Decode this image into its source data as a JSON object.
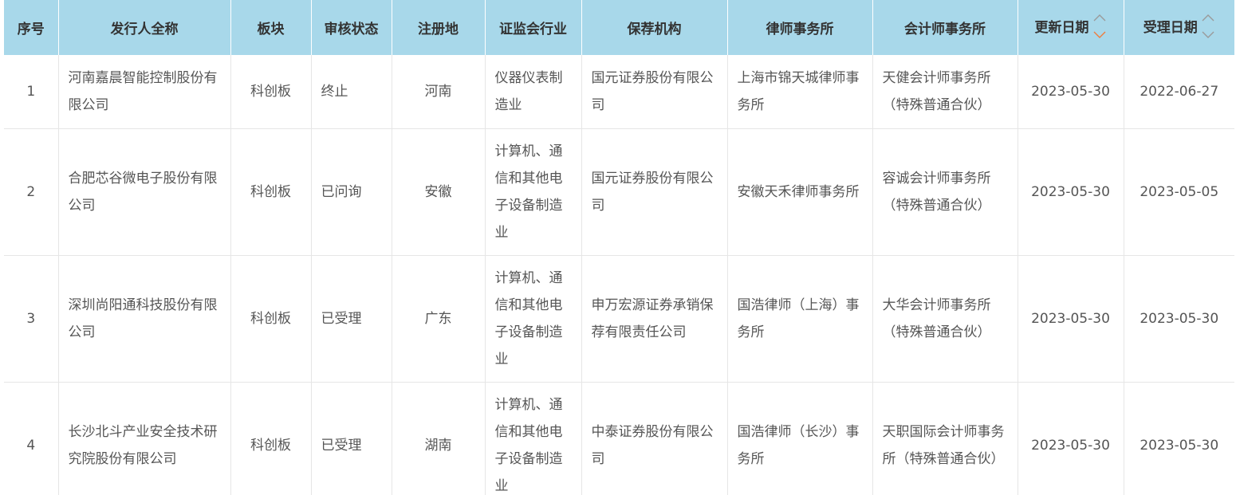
{
  "table": {
    "headers": [
      "序号",
      "发行人全称",
      "板块",
      "审核状态",
      "注册地",
      "证监会行业",
      "保荐机构",
      "律师事务所",
      "会计师事务所",
      "更新日期",
      "受理日期"
    ],
    "sort_colors": {
      "inactive": "#9a9a9a",
      "active": "#f07c3c"
    },
    "rows": [
      {
        "index": "1",
        "issuer": "河南嘉晨智能控制股份有限公司",
        "board": "科创板",
        "status": "终止",
        "region": "河南",
        "industry": "仪器仪表制造业",
        "sponsor": "国元证券股份有限公司",
        "law_firm": "上海市锦天城律师事务所",
        "accounting_firm": "天健会计师事务所（特殊普通合伙）",
        "updated": "2023-05-30",
        "accepted": "2022-06-27"
      },
      {
        "index": "2",
        "issuer": "合肥芯谷微电子股份有限公司",
        "board": "科创板",
        "status": "已问询",
        "region": "安徽",
        "industry": "计算机、通信和其他电子设备制造业",
        "sponsor": "国元证券股份有限公司",
        "law_firm": "安徽天禾律师事务所",
        "accounting_firm": "容诚会计师事务所（特殊普通合伙）",
        "updated": "2023-05-30",
        "accepted": "2023-05-05"
      },
      {
        "index": "3",
        "issuer": "深圳尚阳通科技股份有限公司",
        "board": "科创板",
        "status": "已受理",
        "region": "广东",
        "industry": "计算机、通信和其他电子设备制造业",
        "sponsor": "申万宏源证券承销保荐有限责任公司",
        "law_firm": "国浩律师（上海）事务所",
        "accounting_firm": "大华会计师事务所（特殊普通合伙）",
        "updated": "2023-05-30",
        "accepted": "2023-05-30"
      },
      {
        "index": "4",
        "issuer": "长沙北斗产业安全技术研究院股份有限公司",
        "board": "科创板",
        "status": "已受理",
        "region": "湖南",
        "industry": "计算机、通信和其他电子设备制造业",
        "sponsor": "中泰证券股份有限公司",
        "law_firm": "国浩律师（长沙）事务所",
        "accounting_firm": "天职国际会计师事务所（特殊普通合伙）",
        "updated": "2023-05-30",
        "accepted": "2023-05-30"
      }
    ]
  }
}
